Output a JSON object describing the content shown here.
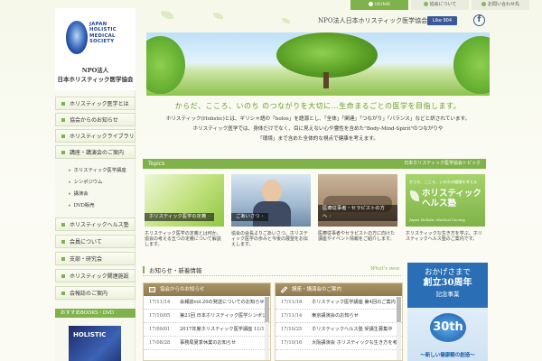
{
  "top_nav": [
    {
      "label": "HOME",
      "icon": "home-icon",
      "active": true
    },
    {
      "label": "協会について",
      "icon": "circle-arrow-icon",
      "active": false
    },
    {
      "label": "お問い合わせ先",
      "icon": "circle-arrow-icon",
      "active": false
    }
  ],
  "header": {
    "org_line": "NPO法人日本ホリスティック医学協会",
    "fb_like": "Like 904",
    "fb_icon": "facebook-icon"
  },
  "logo": {
    "en_lines": [
      "JAPAN",
      "HOLISTIC",
      "MEDICAL",
      "SOCIETY"
    ],
    "ja_line1": "NPO法人",
    "ja_line2": "日本ホリスティック医学協会"
  },
  "sidebar": {
    "menu_top": [
      {
        "label": "ホリスティック医学とは"
      },
      {
        "label": "協会からのお知らせ"
      },
      {
        "label": "ホリスティックライブラリー"
      },
      {
        "label": "講座・講演会のご案内"
      }
    ],
    "submenu": [
      {
        "label": "ホリスティック医学講座"
      },
      {
        "label": "シンポジウム"
      },
      {
        "label": "講演会"
      },
      {
        "label": "DVD販売"
      }
    ],
    "menu_bottom": [
      {
        "label": "ホリスティックヘルス塾"
      },
      {
        "label": "会員について"
      },
      {
        "label": "支部・研究会"
      },
      {
        "label": "ホリスティック関連施設"
      },
      {
        "label": "会報誌のご案内"
      }
    ],
    "books_header": "おすすめBOOKS・DVD",
    "book_title": "HOLISTIC"
  },
  "hero": {
    "slogan": "からだ、こころ、いのち のつながりを大切に…生命まるごとの医学を目指します。",
    "intro": [
      "ホリスティック(Holistic)とは、ギリシャ語の「holos」を語源とし、「全体」「関連」「つながり」「バランス」などと訳されています。",
      "ホリスティック医学では、身体だけでなく、目に見えない心や霊性を含めた\"Body-Mind-Spirit\"のつながりや",
      "「環境」まで含めた全体的な視点で健康を考えます。"
    ]
  },
  "topics": {
    "title": "Topics",
    "subtitle": "日本ホリスティック医学協会トピック",
    "cards": [
      {
        "label": "ホリスティック医学の定義",
        "text": "ホリスティック医学の定義とは何か、協会の考える五つの定義について解説します。"
      },
      {
        "label": "ごあいさつ",
        "text": "協会の会長よりごあいさつ。ホリスティック医学の歩みと今後の展望をお伝えします。"
      },
      {
        "label": "医療従事者・セラピストの方へ",
        "text": "医療従事者やセラピストの方に向けた講座やイベント情報をご紹介します。"
      },
      {
        "label": "ホリスティックヘルス塾",
        "banner_caption": "からだ、こころ、いのちの健康を考える",
        "banner_en": "Japan Holistic Medical Society",
        "text": "ホリスティックな生き方を学ぶ、ホリスティックヘルス塾のご案内です。"
      }
    ]
  },
  "news": {
    "heading": "お知らせ・新着情報",
    "whats_new": "What's new",
    "left_panel": {
      "title": "協会からのお知らせ",
      "items": [
        {
          "date": "17/11/14",
          "text": "会報誌vol.20の発送についてのお知らせ"
        },
        {
          "date": "17/10/05",
          "text": "第21回 日本ホリスティック医学シンポジウム開催"
        },
        {
          "date": "17/09/01",
          "text": "2017年度ホリスティック医学講座 11/12開催"
        },
        {
          "date": "17/08/28",
          "text": "事務局夏季休業のお知らせ"
        }
      ]
    },
    "right_panel": {
      "title": "講座・講演会のご案内",
      "items": [
        {
          "date": "17/11/18",
          "text": "ホリスティック医学講座 第4回のご案内"
        },
        {
          "date": "17/11/14",
          "text": "東京講演会のお知らせ"
        },
        {
          "date": "17/10/25",
          "text": "ホリスティックヘルス塾 受講生募集中"
        },
        {
          "date": "17/10/16",
          "text": "大阪講演会 ホリスティックな生き方を考える"
        }
      ]
    }
  },
  "banner": {
    "line1": "おかげさまで",
    "line2": "創立30周年",
    "line3": "記念事業",
    "badge": "30th",
    "bottom": "〜新しい健康観の創造〜"
  },
  "colors": {
    "accent": "#7fb24a",
    "panel_header": "#9c8658",
    "facebook": "#3b5998",
    "banner_blue": "#2a6fb5"
  }
}
